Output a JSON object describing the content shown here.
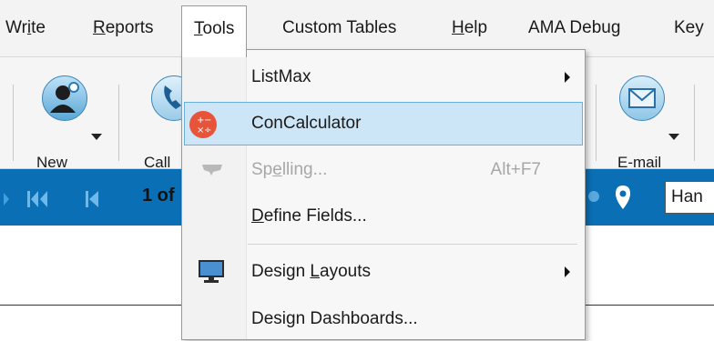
{
  "menubar": {
    "items": [
      {
        "pre": "Wr",
        "acc": "i",
        "post": "te"
      },
      {
        "pre": "",
        "acc": "R",
        "post": "eports"
      },
      {
        "pre": "",
        "acc": "T",
        "post": "ools"
      },
      {
        "pre": "Custom Tables",
        "acc": "",
        "post": ""
      },
      {
        "pre": "",
        "acc": "H",
        "post": "elp"
      },
      {
        "pre": "AMA Debug",
        "acc": "",
        "post": ""
      },
      {
        "pre": "Key",
        "acc": "",
        "post": ""
      }
    ]
  },
  "ribbon": {
    "new_label": "New",
    "call_label": "Call",
    "email_label": "E-mail"
  },
  "navbar": {
    "record_position": "1 of",
    "search_value": "Han"
  },
  "tools_menu": {
    "items": [
      {
        "pre": "ListMax",
        "acc": "",
        "post": "",
        "shortcut": "",
        "submenu": true,
        "icon": "",
        "disabled": false,
        "hot": false
      },
      {
        "pre": "ConCalculator",
        "acc": "",
        "post": "",
        "shortcut": "",
        "submenu": false,
        "icon": "calculator-icon",
        "disabled": false,
        "hot": true
      },
      {
        "pre": "Sp",
        "acc": "e",
        "post": "lling...",
        "shortcut": "Alt+F7",
        "submenu": false,
        "icon": "spelling-icon",
        "disabled": true,
        "hot": false
      },
      {
        "pre": "",
        "acc": "D",
        "post": "efine Fields...",
        "shortcut": "",
        "submenu": false,
        "icon": "",
        "disabled": false,
        "hot": false
      },
      {
        "pre": "Design ",
        "acc": "L",
        "post": "ayouts",
        "shortcut": "",
        "submenu": true,
        "icon": "monitor-icon",
        "disabled": false,
        "hot": false
      },
      {
        "pre": "Design Dashboards...",
        "acc": "",
        "post": "",
        "shortcut": "",
        "submenu": false,
        "icon": "",
        "disabled": false,
        "hot": false
      }
    ]
  },
  "colors": {
    "nav_blue": "#0a6fb4",
    "highlight": "#cde6f7",
    "calculator_orange": "#e8543a"
  }
}
